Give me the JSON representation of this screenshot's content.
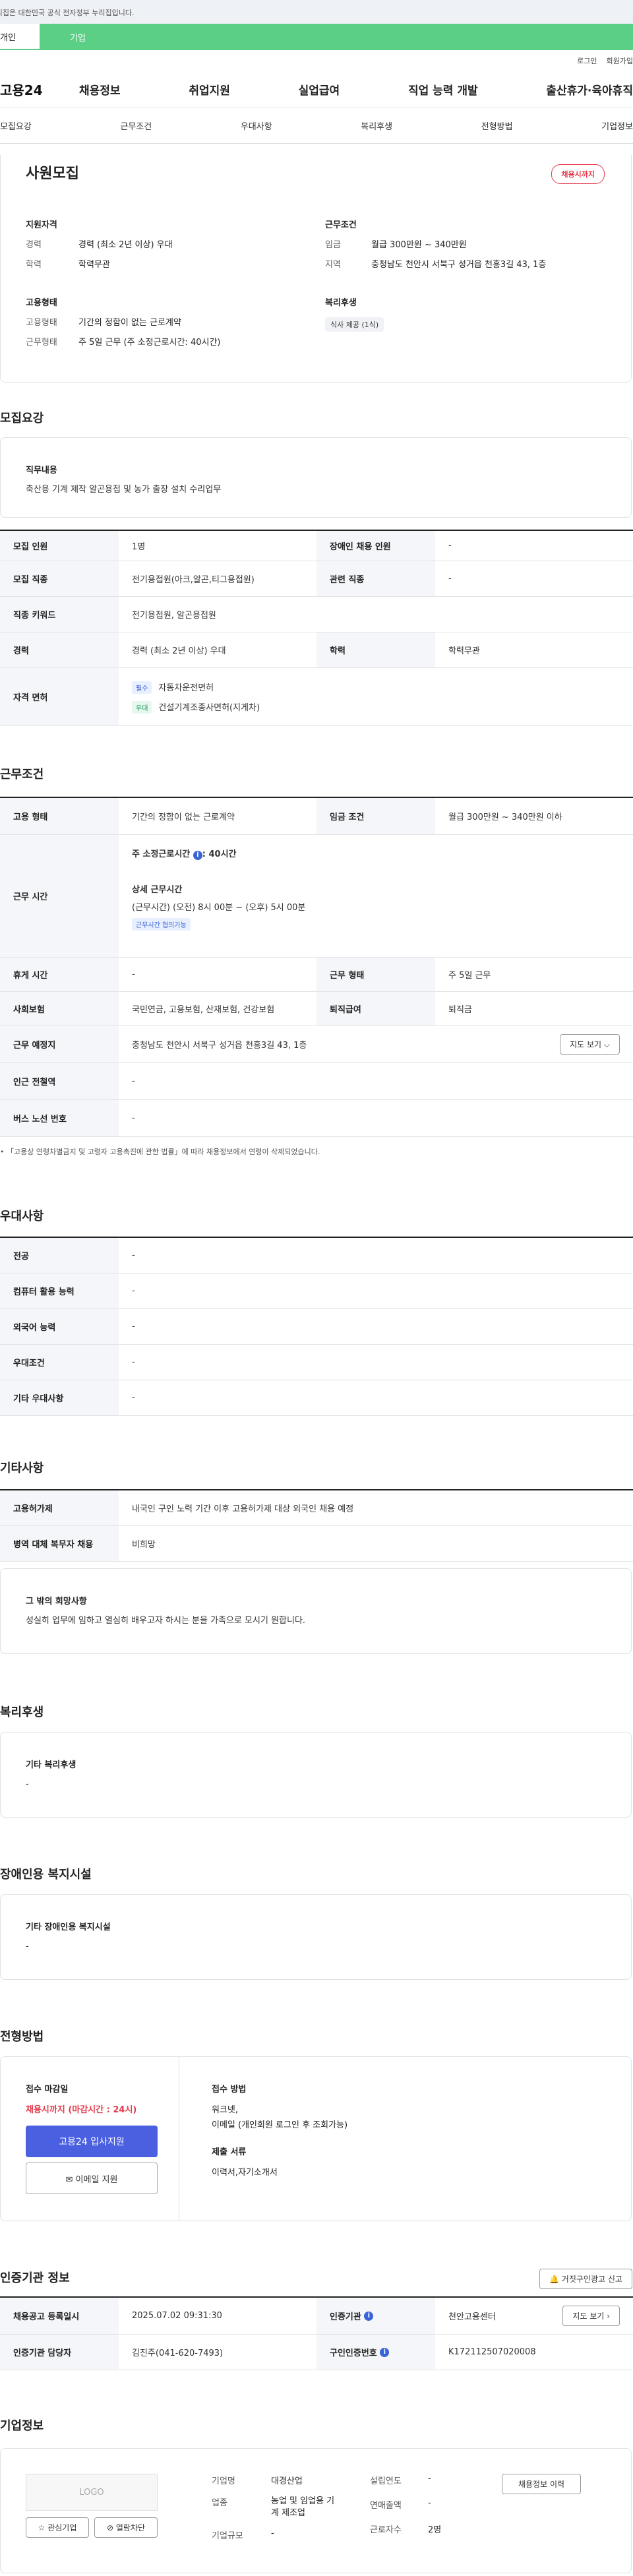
{
  "notice": "이 누리집은 대한민국 공식 전자정부 누리집입니다.",
  "user_tabs": [
    "개인",
    "기업"
  ],
  "util": [
    "로그인",
    "회원가입"
  ],
  "logo": "고용24",
  "gnb": [
    "채용정보",
    "취업지원",
    "실업급여",
    "직업 능력 개발",
    "출산휴가·육아휴직"
  ],
  "subnav": [
    "모집요강",
    "근무조건",
    "우대사항",
    "복리후생",
    "전형방법",
    "기업정보"
  ],
  "hero": {
    "title": "사원모집",
    "badge": "채용시까지",
    "qual_title": "지원자격",
    "career_k": "경력",
    "career_v": "경력 (최소 2년 이상) 우대",
    "edu_k": "학력",
    "edu_v": "학력무관",
    "emp_title": "고용형태",
    "emp_k": "고용형태",
    "emp_v": "기간의 정함이 없는 근로계약",
    "work_k": "근무형태",
    "work_v": "주 5일 근무 (주 소정근로시간: 40시간)",
    "cond_title": "근무조건",
    "wage_k": "임금",
    "wage_v": "월급 300만원 ~ 340만원",
    "area_k": "지역",
    "area_v": "충청남도 천안시 서북구 성거읍 천흥3길 43, 1층",
    "welfare_title": "복리후생",
    "welfare_chip": "식사 제공 (1식)"
  },
  "recruit": {
    "title": "모집요강",
    "job_h": "직무내용",
    "job_v": "축산용 기계 제작 알곤용접 및 농가 출장 설치 수리업무",
    "rows": {
      "count_k": "모집 인원",
      "count_v": "1명",
      "disab_k": "장애인 채용 인원",
      "disab_v": "-",
      "job_k": "모집 직종",
      "job_v": "전기용접원(아크,알곤,티그용접원)",
      "rel_k": "관련 직종",
      "rel_v": "-",
      "kw_k": "직종 키워드",
      "kw_v": "전기용접원, 알곤용접원",
      "career_k": "경력",
      "career_v": "경력 (최소 2년 이상) 우대",
      "edu_k": "학력",
      "edu_v": "학력무관",
      "lic_k": "자격 면허",
      "lic1_tag": "필수",
      "lic1": "자동차운전면허",
      "lic2_tag": "우대",
      "lic2": "건설기계조종사면허(지게차)"
    }
  },
  "work": {
    "title": "근무조건",
    "type_k": "고용 형태",
    "type_v": "기간의 정함이 없는 근로계약",
    "wage_k": "임금 조건",
    "wage_v": "월급 300만원 ~ 340만원 이하",
    "time_k": "근무 시간",
    "hours_label": "주 소정근로시간",
    "hours_v": ": 40시간",
    "detail_label": "상세 근무시간",
    "detail_v": "(근무시간) (오전) 8시 00분 ~ (오후) 5시 00분",
    "detail_tag": "근무시간 협의가능",
    "rest_k": "휴게 시간",
    "rest_v": "-",
    "form_k": "근무 형태",
    "form_v": "주 5일 근무",
    "ins_k": "사회보험",
    "ins_v": "국민연금, 고용보험, 산재보험, 건강보험",
    "ret_k": "퇴직급여",
    "ret_v": "퇴직금",
    "place_k": "근무 예정지",
    "place_v": "충청남도 천안시 서북구 성거읍 천흥3길 43, 1층",
    "map_btn": "지도 보기",
    "sub_k": "인근 전철역",
    "sub_v": "-",
    "bus_k": "버스 노선 번호",
    "bus_v": "-",
    "note": "「고용상 연령차별금지 및 고령자 고용촉진에 관한 법률」에 따라 채용정보에서 연령이 삭제되었습니다."
  },
  "pref": {
    "title": "우대사항",
    "major_k": "전공",
    "major_v": "-",
    "pc_k": "컴퓨터 활용 능력",
    "pc_v": "-",
    "lang_k": "외국어 능력",
    "lang_v": "-",
    "cond_k": "우대조건",
    "cond_v": "-",
    "etc_k": "기타 우대사항",
    "etc_v": "-"
  },
  "etc": {
    "title": "기타사항",
    "hire_k": "고용허가제",
    "hire_v": "내국인 구인 노력 기간 이후 고용허가제 대상 외국인 채용 예정",
    "mil_k": "병역 대체 복무자 채용",
    "mil_v": "비희망",
    "other_h": "그 밖의 희망사항",
    "other_v": "성실히 업무에 임하고 열심히 배우고자 하시는 분을 가족으로 모시기 원합니다."
  },
  "welfare": {
    "title": "복리후생",
    "h": "기타 복리후생",
    "v": "-"
  },
  "disab": {
    "title": "장애인용 복지시설",
    "h": "기타 장애인용 복지시설",
    "v": "-"
  },
  "process": {
    "title": "전형방법",
    "deadline_h": "접수 마감일",
    "deadline_v": "채용시까지 (마감시간 : 24시)",
    "apply_btn": "고용24 입사지원",
    "email_btn": "이메일 지원",
    "method_h": "접수 방법",
    "method_v1": "워크넷,",
    "method_v2": "이메일 (개인회원 로그인 후 조회가능)",
    "docs_h": "제출 서류",
    "docs_v": "이력서,자기소개서"
  },
  "cert": {
    "title": "인증기관 정보",
    "report_btn": "거짓구인광고 신고",
    "reg_k": "채용공고 등록일시",
    "reg_v": "2025.07.02 09:31:30",
    "org_k": "인증기관",
    "org_v": "천안고용센터",
    "map_btn": "지도 보기",
    "mgr_k": "인증기관 담당자",
    "mgr_v": "김진주(041-620-7493)",
    "no_k": "구인인증번호",
    "no_v": "K172112507020008"
  },
  "company": {
    "title": "기업정보",
    "logo": "LOGO",
    "fav_btn": "관심기업",
    "block_btn": "열람차단",
    "name_k": "기업명",
    "name_v": "대경산업",
    "ind_k": "업종",
    "ind_v1": "농업 및 임업용 기",
    "ind_v2": "계 제조업",
    "size_k": "기업규모",
    "size_v": "-",
    "year_k": "설립연도",
    "year_v": "-",
    "sales_k": "연매출액",
    "sales_v": "-",
    "emp_k": "근로자수",
    "emp_v": "2명",
    "history_btn": "채용정보 이력"
  }
}
